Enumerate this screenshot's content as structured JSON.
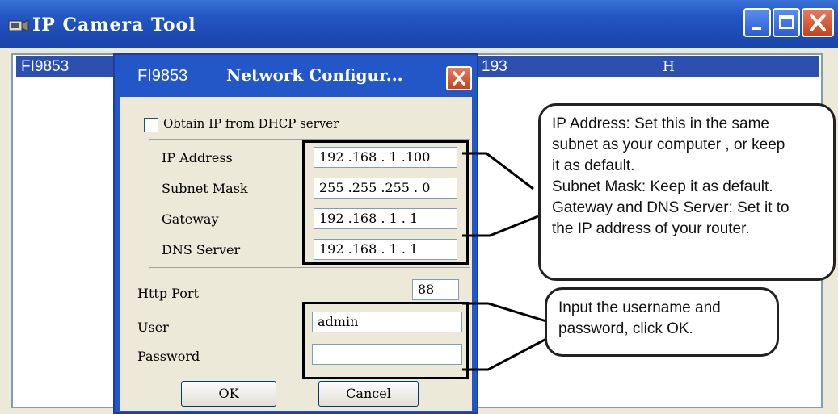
{
  "window": {
    "title": "IP Camera Tool"
  },
  "device_list": {
    "row": {
      "name": "FI9853",
      "ip": "193",
      "status": "H"
    }
  },
  "dialog": {
    "device_name": "FI9853",
    "title": "Network Configur...",
    "dhcp_label": "Obtain IP from DHCP server",
    "fields": {
      "ip_address": {
        "label": "IP Address",
        "value": "192 .168 . 1  .100"
      },
      "subnet_mask": {
        "label": "Subnet Mask",
        "value": "255 .255 .255 . 0"
      },
      "gateway": {
        "label": "Gateway",
        "value": "192 .168 . 1  . 1"
      },
      "dns_server": {
        "label": "DNS Server",
        "value": "192 .168 . 1  . 1"
      },
      "http_port": {
        "label": "Http Port",
        "value": "88"
      },
      "user": {
        "label": "User",
        "value": "admin"
      },
      "password": {
        "label": "Password",
        "value": ""
      }
    },
    "ok_label": "OK",
    "cancel_label": "Cancel"
  },
  "callouts": {
    "ip": [
      "IP Address: Set this in the same",
      "subnet as your computer , or keep",
      "it as default.",
      "Subnet Mask: Keep it as default.",
      "Gateway and DNS Server: Set it to",
      "the IP address of your router."
    ],
    "user": [
      "Input the username and",
      "password, click OK."
    ]
  }
}
